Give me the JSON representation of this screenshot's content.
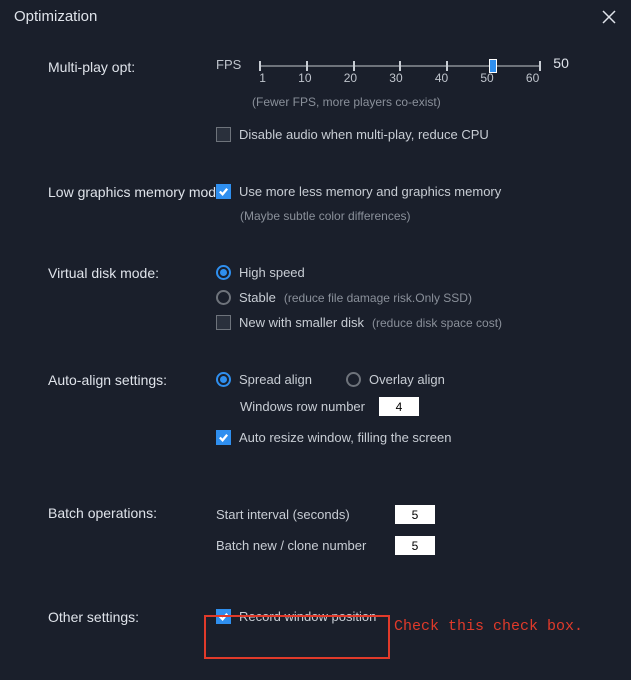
{
  "window": {
    "title": "Optimization"
  },
  "multiPlay": {
    "label": "Multi-play opt:",
    "fpsLabel": "FPS",
    "fpsValue": "50",
    "ticks": [
      "1",
      "10",
      "20",
      "30",
      "40",
      "50",
      "60"
    ],
    "hint": "(Fewer FPS, more players co-exist)",
    "disableAudioLabel": "Disable audio when multi-play, reduce CPU"
  },
  "lowGraphics": {
    "label": "Low graphics memory mode:",
    "checkboxLabel": "Use more less memory and graphics memory",
    "hint": "(Maybe subtle color differences)"
  },
  "virtualDisk": {
    "label": "Virtual disk mode:",
    "highSpeed": "High speed",
    "stable": "Stable",
    "stableHint": "(reduce file damage risk.Only SSD)",
    "newSmaller": "New with smaller disk",
    "newSmallerHint": "(reduce disk space cost)"
  },
  "autoAlign": {
    "label": "Auto-align settings:",
    "spread": "Spread align",
    "overlay": "Overlay align",
    "rowNumLabel": "Windows row number",
    "rowNumValue": "4",
    "autoResize": "Auto resize window, filling the screen"
  },
  "batch": {
    "label": "Batch operations:",
    "startIntervalLabel": "Start interval (seconds)",
    "startIntervalValue": "5",
    "cloneLabel": "Batch new / clone number",
    "cloneValue": "5"
  },
  "other": {
    "label": "Other settings:",
    "recordPos": "Record window position"
  },
  "annotation": {
    "text": "Check this check box."
  }
}
